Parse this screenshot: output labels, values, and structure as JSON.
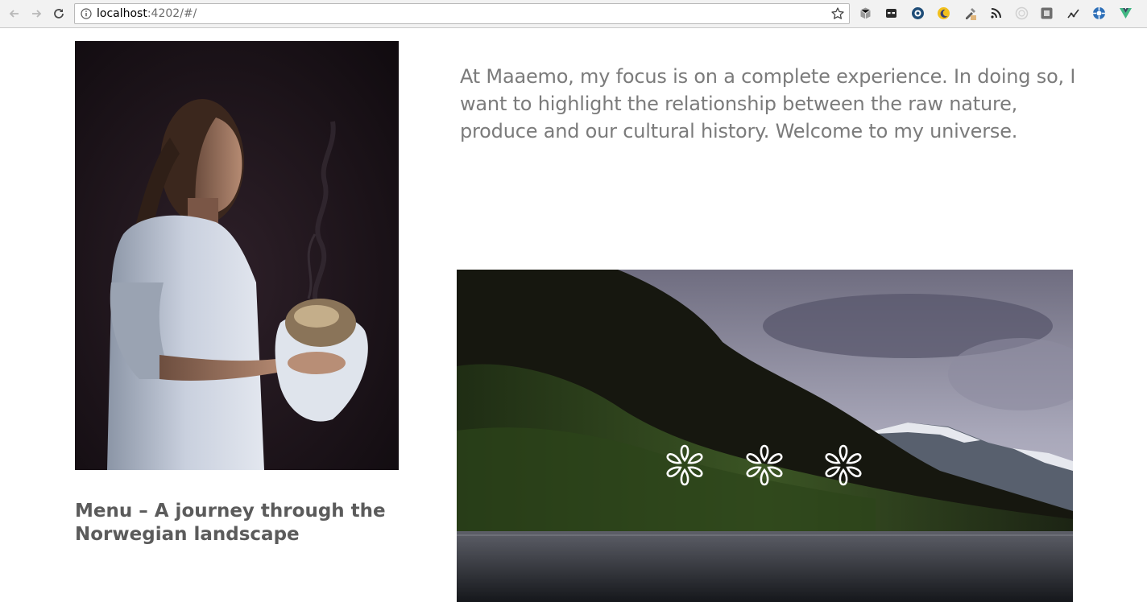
{
  "browser": {
    "url_host": "localhost",
    "url_path": ":4202/#/",
    "extensions": [
      "cube-icon",
      "mask-icon",
      "ghostery-icon",
      "moon-icon",
      "eyedropper-icon",
      "rss-icon",
      "circle-icon",
      "square-icon",
      "graph-icon",
      "puzzle-icon",
      "vue-icon"
    ]
  },
  "main": {
    "intro": "At Maaemo, my focus is on a complete experience. In doing so, I want to highlight the relationship between the raw nature, produce and our cultural history. Welcome to my universe.",
    "menu_title": "Menu – A journey through the Norwegian landscape"
  },
  "michelin_stars": 3,
  "colors": {
    "intro_text": "#7b7b7b",
    "heading_text": "#5b5b5b"
  }
}
